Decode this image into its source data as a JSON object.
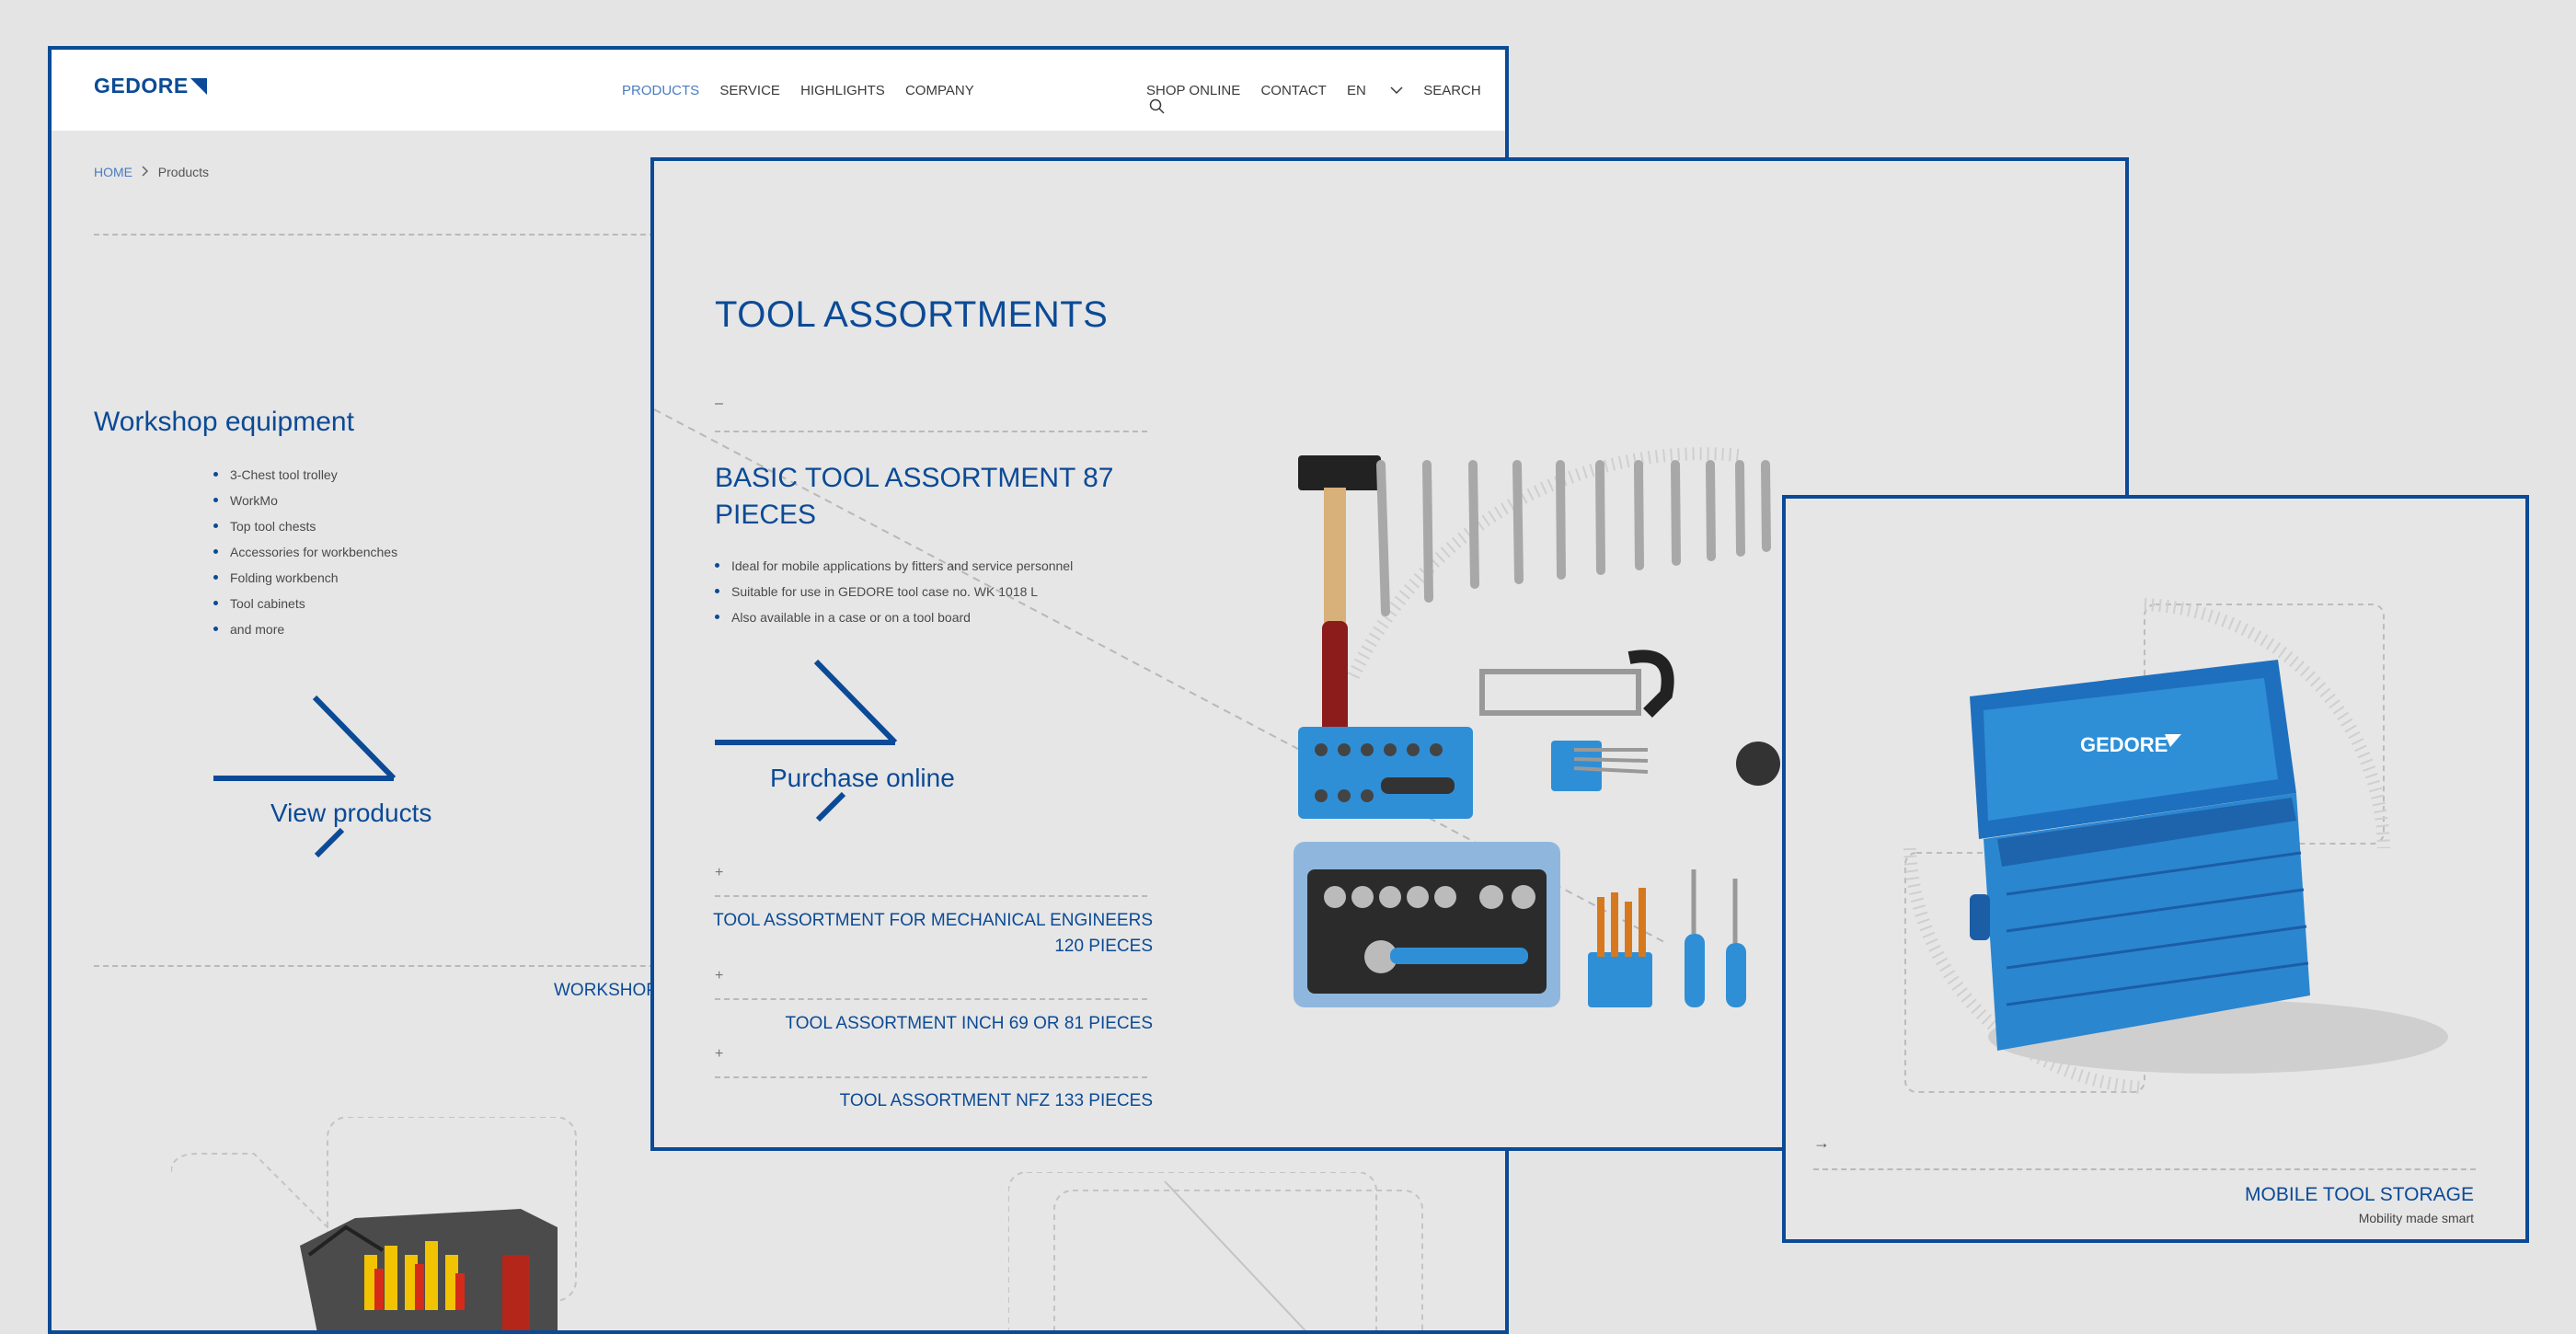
{
  "back_page": {
    "brand": "GEDORE",
    "nav_main": [
      "PRODUCTS",
      "SERVICE",
      "HIGHLIGHTS",
      "COMPANY"
    ],
    "nav_right": {
      "shop": "SHOP ONLINE",
      "contact": "CONTACT",
      "language": "EN",
      "search": "SEARCH"
    },
    "breadcrumb": {
      "home": "HOME",
      "current": "Products"
    },
    "section_title": "Workshop equipment",
    "items": [
      "3-Chest tool trolley",
      "WorkMo",
      "Top tool chests",
      "Accessories for workbenches",
      "Folding workbench",
      "Tool cabinets",
      "and more"
    ],
    "cta": "View products",
    "cut_label": "WORKSHOP"
  },
  "middle_panel": {
    "title": "TOOL ASSORTMENTS",
    "dash": "–",
    "product_title": "BASIC TOOL ASSORTMENT 87 PIECES",
    "features": [
      "Ideal for mobile applications by fitters and service personnel",
      "Suitable for use in GEDORE tool case no. WK 1018 L",
      "Also available in a case or on a tool board"
    ],
    "cta": "Purchase online",
    "accordion": [
      {
        "line1": "TOOL ASSORTMENT FOR MECHANICAL ENGINEERS",
        "line2": "120 PIECES"
      },
      {
        "line1": "TOOL ASSORTMENT INCH 69 OR 81 PIECES",
        "line2": ""
      },
      {
        "line1": "TOOL ASSORTMENT NFZ 133 PIECES",
        "line2": ""
      }
    ],
    "plus": "+"
  },
  "front_panel": {
    "arrow": "→",
    "title": "MOBILE TOOL STORAGE",
    "subtitle": "Mobility made smart",
    "box_brand": "GEDORE"
  },
  "colors": {
    "brand_blue": "#0b4a96",
    "tool_blue": "#2f8fd6",
    "background": "#e6e6e6"
  }
}
